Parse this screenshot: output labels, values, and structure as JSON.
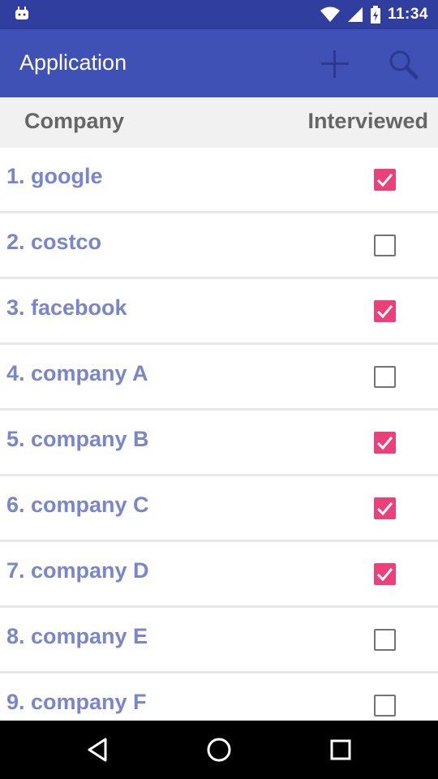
{
  "status_bar": {
    "time": "11:34",
    "icons": [
      "android-icon",
      "wifi-icon",
      "signal-icon",
      "battery-icon"
    ]
  },
  "app_bar": {
    "title": "Application",
    "actions": [
      "add-icon",
      "search-icon"
    ]
  },
  "header": {
    "company_label": "Company",
    "interviewed_label": "Interviewed"
  },
  "companies": [
    {
      "label": "1. google",
      "interviewed": true
    },
    {
      "label": "2. costco",
      "interviewed": false
    },
    {
      "label": "3. facebook",
      "interviewed": true
    },
    {
      "label": "4. company A",
      "interviewed": false
    },
    {
      "label": "5. company B",
      "interviewed": true
    },
    {
      "label": "6. company C",
      "interviewed": true
    },
    {
      "label": "7. company D",
      "interviewed": true
    },
    {
      "label": "8. company E",
      "interviewed": false
    },
    {
      "label": "9. company F",
      "interviewed": false
    }
  ],
  "nav_bar": {
    "buttons": [
      "back-icon",
      "home-icon",
      "recents-icon"
    ]
  },
  "colors": {
    "primary": "#3f51b5",
    "primary_dark": "#303f9f",
    "accent": "#ec407a",
    "item_text": "#7986cb"
  }
}
